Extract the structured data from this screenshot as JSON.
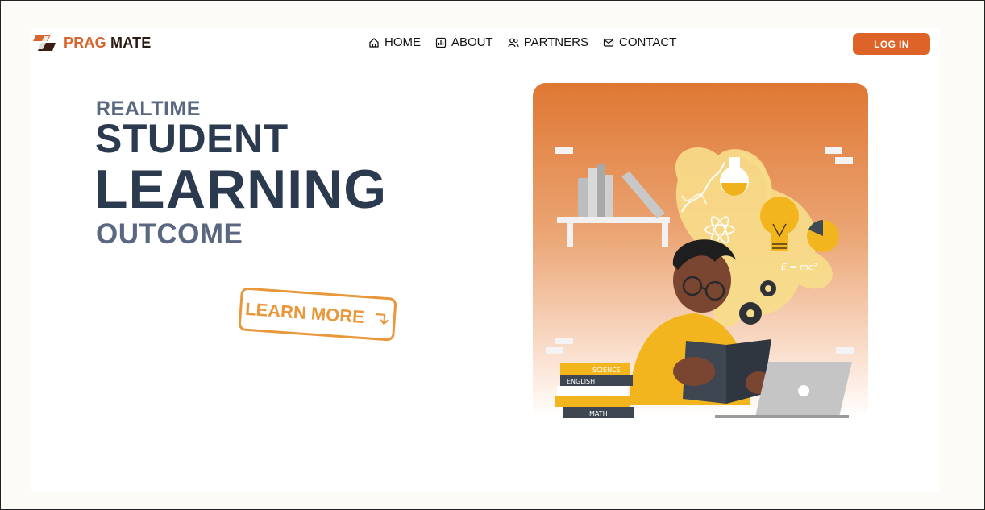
{
  "brand": {
    "part1": "PRAG",
    "part2": "MATE",
    "mark_icon": "logo-mark-icon"
  },
  "nav": {
    "items": [
      {
        "label": "HOME",
        "icon": "home-icon"
      },
      {
        "label": "ABOUT",
        "icon": "chart-icon"
      },
      {
        "label": "PARTNERS",
        "icon": "users-icon"
      },
      {
        "label": "CONTACT",
        "icon": "mail-icon"
      }
    ],
    "login_label": "LOG IN"
  },
  "hero": {
    "line1": "REALTIME",
    "line2": "STUDENT",
    "line3": "LEARNING",
    "line4": "OUTCOME",
    "cta_label": "LEARN MORE",
    "cta_icon": "arrow-down-right-icon"
  },
  "illustration": {
    "books": [
      "SCIENCE",
      "ENGLISH",
      "MATH"
    ],
    "formula": "E = mc²"
  },
  "colors": {
    "accent": "#de6328",
    "cta": "#e8973a",
    "heading_dark": "#2c3a4f",
    "heading_light": "#5a6780"
  }
}
